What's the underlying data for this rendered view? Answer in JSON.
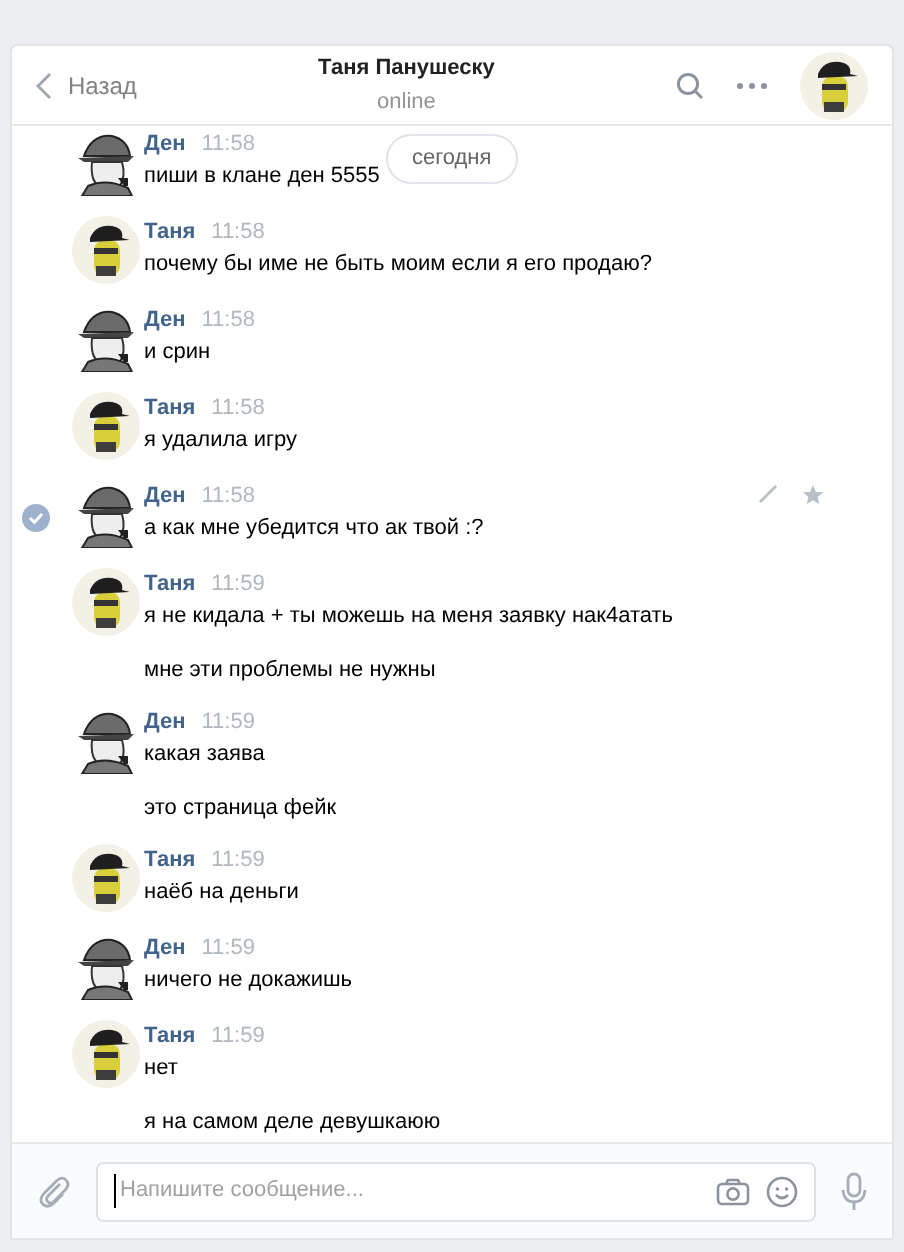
{
  "header": {
    "back": "Назад",
    "title": "Таня Панушеску",
    "status": "online"
  },
  "date_pill": "сегодня",
  "messages": [
    {
      "sender": "Ден",
      "kind": "detective",
      "time": "11:58",
      "selected": false,
      "paragraphs": [
        "пиши в клане ден 5555"
      ]
    },
    {
      "sender": "Таня",
      "kind": "cap",
      "time": "11:58",
      "selected": false,
      "paragraphs": [
        "почему бы име не быть моим если я его продаю?"
      ]
    },
    {
      "sender": "Ден",
      "kind": "detective",
      "time": "11:58",
      "selected": false,
      "paragraphs": [
        "и срин"
      ]
    },
    {
      "sender": "Таня",
      "kind": "cap",
      "time": "11:58",
      "selected": false,
      "paragraphs": [
        "я удалила игру"
      ]
    },
    {
      "sender": "Ден",
      "kind": "detective",
      "time": "11:58",
      "selected": true,
      "paragraphs": [
        "а как мне убедится что ак твой :?"
      ]
    },
    {
      "sender": "Таня",
      "kind": "cap",
      "time": "11:59",
      "selected": false,
      "paragraphs": [
        "я не кидала + ты можешь на меня заявку нак4атать",
        "мне эти проблемы не нужны"
      ]
    },
    {
      "sender": "Ден",
      "kind": "detective",
      "time": "11:59",
      "selected": false,
      "paragraphs": [
        "какая заява",
        "это страница фейк"
      ]
    },
    {
      "sender": "Таня",
      "kind": "cap",
      "time": "11:59",
      "selected": false,
      "paragraphs": [
        "наёб на деньги"
      ]
    },
    {
      "sender": "Ден",
      "kind": "detective",
      "time": "11:59",
      "selected": false,
      "paragraphs": [
        "ничего не докажишь"
      ]
    },
    {
      "sender": "Таня",
      "kind": "cap",
      "time": "11:59",
      "selected": false,
      "paragraphs": [
        "нет",
        "я на самом деле девушкаюю"
      ]
    }
  ],
  "composer": {
    "placeholder": "Напишите сообщение..."
  }
}
